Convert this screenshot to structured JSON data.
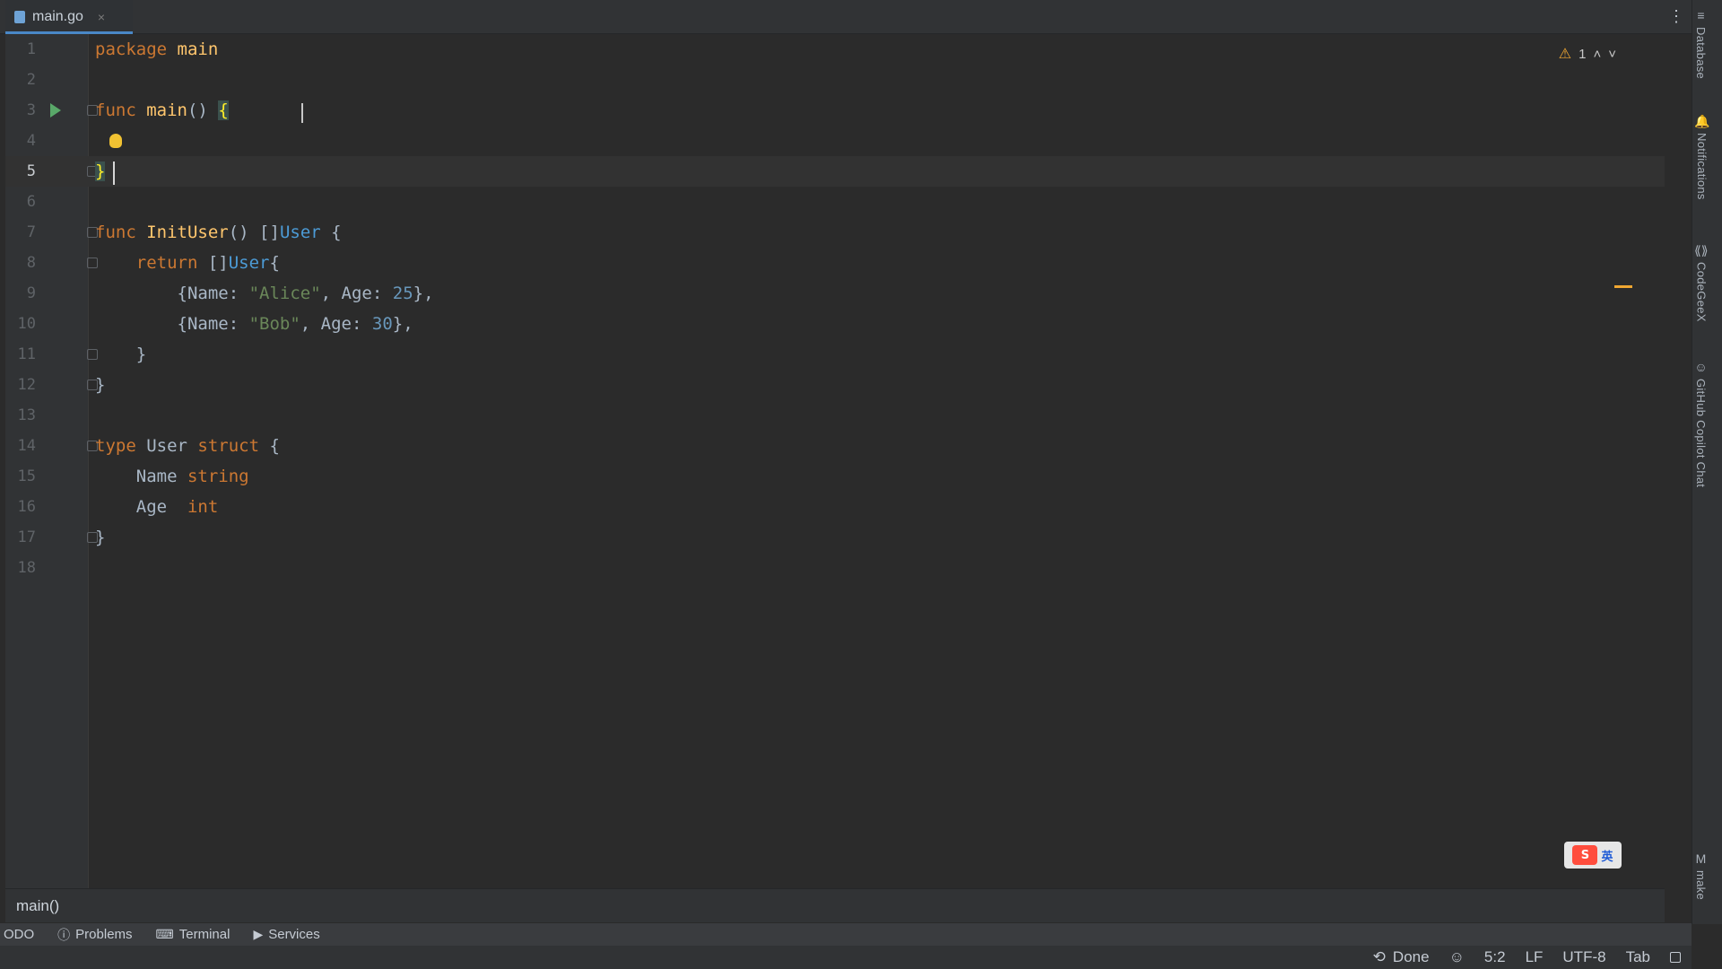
{
  "tabbar": {
    "active_tab": {
      "label": "main.go",
      "close": "×"
    },
    "kebab": "⋮"
  },
  "right_stripe": {
    "items": [
      {
        "name": "Database",
        "icon": "database-icon",
        "glyph": "≡"
      },
      {
        "name": "Notifications",
        "icon": "bell-icon",
        "glyph": "🔔"
      },
      {
        "name": "CodeGeeX",
        "icon": "codegeex-icon",
        "glyph": "⟪⟫"
      },
      {
        "name": "GitHub Copilot Chat",
        "icon": "copilot-icon",
        "glyph": "☺"
      },
      {
        "name": "make",
        "icon": "make-icon",
        "glyph": "M"
      }
    ]
  },
  "editor": {
    "warnings": {
      "count": "1"
    },
    "current_line": 5,
    "lines": [
      {
        "n": "1",
        "tokens": [
          {
            "c": "k",
            "t": "package"
          },
          {
            "c": "plain",
            "t": " "
          },
          {
            "c": "f",
            "t": "main"
          }
        ]
      },
      {
        "n": "2",
        "tokens": []
      },
      {
        "n": "3",
        "tokens": [
          {
            "c": "k",
            "t": "func"
          },
          {
            "c": "plain",
            "t": " "
          },
          {
            "c": "f",
            "t": "main"
          },
          {
            "c": "plain",
            "t": "() "
          },
          {
            "c": "bracket-hl",
            "t": "{"
          }
        ]
      },
      {
        "n": "4",
        "tokens": []
      },
      {
        "n": "5",
        "tokens": [
          {
            "c": "bracket-hl",
            "t": "}"
          }
        ]
      },
      {
        "n": "6",
        "tokens": []
      },
      {
        "n": "7",
        "tokens": [
          {
            "c": "k",
            "t": "func"
          },
          {
            "c": "plain",
            "t": " "
          },
          {
            "c": "f",
            "t": "InitUser"
          },
          {
            "c": "plain",
            "t": "() []"
          },
          {
            "c": "t",
            "t": "User"
          },
          {
            "c": "plain",
            "t": " {"
          }
        ]
      },
      {
        "n": "8",
        "tokens": [
          {
            "c": "plain",
            "t": "    "
          },
          {
            "c": "k",
            "t": "return"
          },
          {
            "c": "plain",
            "t": " []"
          },
          {
            "c": "t",
            "t": "User"
          },
          {
            "c": "plain",
            "t": "{"
          }
        ]
      },
      {
        "n": "9",
        "tokens": [
          {
            "c": "plain",
            "t": "        {Name: "
          },
          {
            "c": "s",
            "t": "\"Alice\""
          },
          {
            "c": "plain",
            "t": ", Age: "
          },
          {
            "c": "n",
            "t": "25"
          },
          {
            "c": "plain",
            "t": "},"
          }
        ]
      },
      {
        "n": "10",
        "tokens": [
          {
            "c": "plain",
            "t": "        {Name: "
          },
          {
            "c": "s",
            "t": "\"Bob\""
          },
          {
            "c": "plain",
            "t": ", Age: "
          },
          {
            "c": "n",
            "t": "30"
          },
          {
            "c": "plain",
            "t": "},"
          }
        ]
      },
      {
        "n": "11",
        "tokens": [
          {
            "c": "plain",
            "t": "    }"
          }
        ]
      },
      {
        "n": "12",
        "tokens": [
          {
            "c": "plain",
            "t": "}"
          }
        ]
      },
      {
        "n": "13",
        "tokens": []
      },
      {
        "n": "14",
        "tokens": [
          {
            "c": "k",
            "t": "type"
          },
          {
            "c": "plain",
            "t": " User "
          },
          {
            "c": "k",
            "t": "struct"
          },
          {
            "c": "plain",
            "t": " {"
          }
        ]
      },
      {
        "n": "15",
        "tokens": [
          {
            "c": "plain",
            "t": "    Name "
          },
          {
            "c": "k",
            "t": "string"
          }
        ]
      },
      {
        "n": "16",
        "tokens": [
          {
            "c": "plain",
            "t": "    Age  "
          },
          {
            "c": "k",
            "t": "int"
          }
        ]
      },
      {
        "n": "17",
        "tokens": [
          {
            "c": "plain",
            "t": "}"
          }
        ]
      },
      {
        "n": "18",
        "tokens": []
      }
    ]
  },
  "breadcrumb": {
    "text": "main()"
  },
  "bottom_tools": [
    {
      "label": "ODO",
      "icon": "todo-icon"
    },
    {
      "label": "Problems",
      "icon": "problems-icon"
    },
    {
      "label": "Terminal",
      "icon": "terminal-icon"
    },
    {
      "label": "Services",
      "icon": "services-icon"
    }
  ],
  "statusbar": {
    "done": "Done",
    "position": "5:2",
    "line_sep": "LF",
    "encoding": "UTF-8",
    "indent": "Tab"
  },
  "ime": {
    "logo": "S",
    "text": "英"
  }
}
